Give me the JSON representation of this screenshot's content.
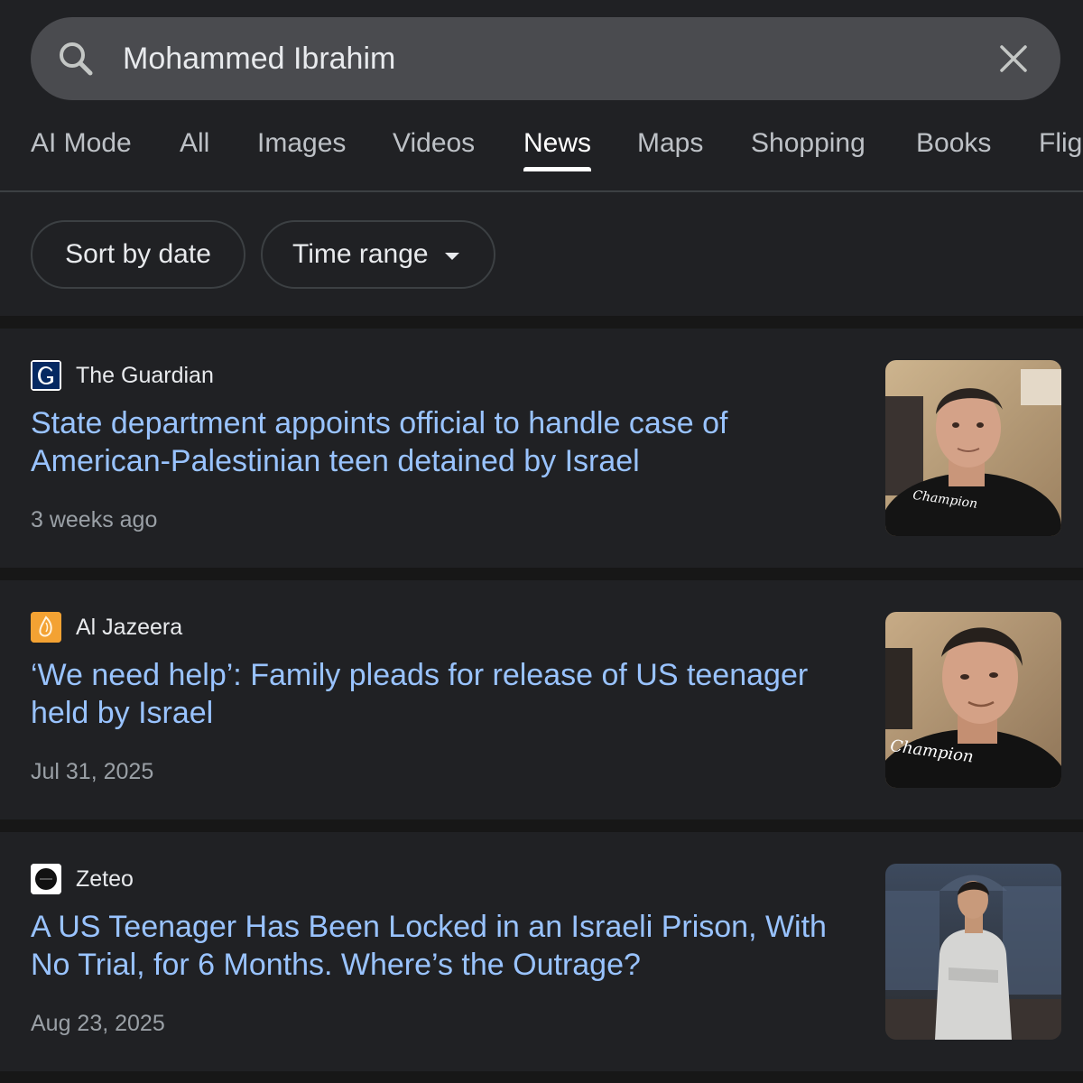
{
  "search": {
    "query": "Mohammed Ibrahim"
  },
  "tabs": [
    {
      "label": "AI Mode"
    },
    {
      "label": "All"
    },
    {
      "label": "Images"
    },
    {
      "label": "Videos"
    },
    {
      "label": "News",
      "active": true
    },
    {
      "label": "Maps"
    },
    {
      "label": "Shopping"
    },
    {
      "label": "Books"
    },
    {
      "label": "Flig"
    }
  ],
  "filters": {
    "sort_label": "Sort by date",
    "time_label": "Time range"
  },
  "results": [
    {
      "source": "The Guardian",
      "logo_icon": "guardian-logo",
      "headline": "State department appoints official to handle case of American-Palestinian teen detained by Israel",
      "date": "3 weeks ago",
      "thumbnail": "teen-portrait-black-shirt"
    },
    {
      "source": "Al Jazeera",
      "logo_icon": "al-jazeera-logo",
      "headline": "‘We need help’: Family pleads for release of US teenager held by Israel",
      "date": "Jul 31, 2025",
      "thumbnail": "teen-portrait-black-shirt-closeup"
    },
    {
      "source": "Zeteo",
      "logo_icon": "zeteo-logo",
      "headline": "A US Teenager Has Been Locked in an Israeli Prison, With No Trial, for 6 Months. Where’s the Outrage?",
      "date": "Aug 23, 2025",
      "thumbnail": "teen-white-hoodie-mosque"
    }
  ],
  "colors": {
    "background": "#202124",
    "search_bar": "#4a4b4f",
    "headline_link": "#99c3ff",
    "muted_text": "#9aa0a6",
    "separator": "#171717"
  }
}
